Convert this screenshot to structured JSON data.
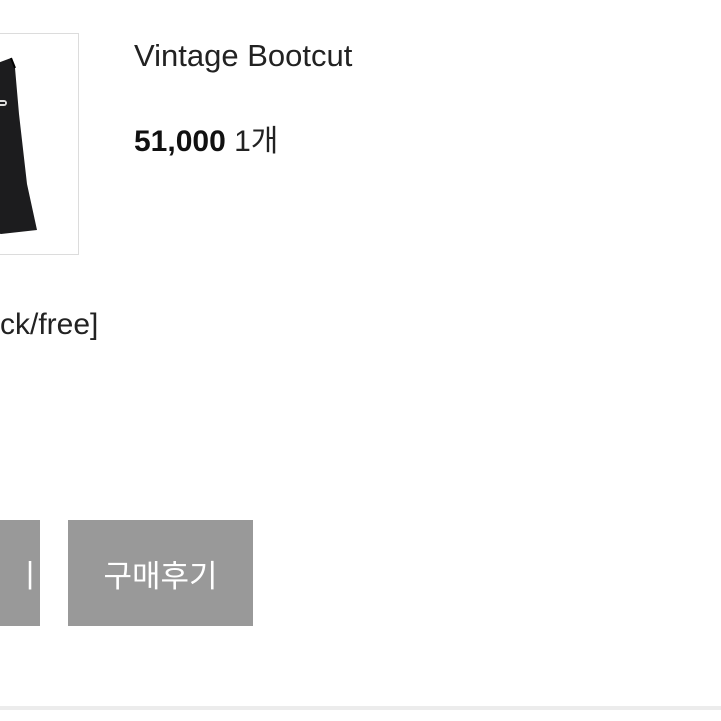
{
  "product": {
    "image_icon": "black-dress-icon",
    "name": "Vintage Bootcut",
    "price": "51,000",
    "quantity": "1개",
    "option": "ck/free]"
  },
  "buttons": {
    "left_label": "|",
    "review_label": "구매후기"
  },
  "colors": {
    "button_bg": "#999999",
    "button_text": "#ffffff",
    "text_primary": "#222222",
    "border": "#dcdcdc"
  }
}
